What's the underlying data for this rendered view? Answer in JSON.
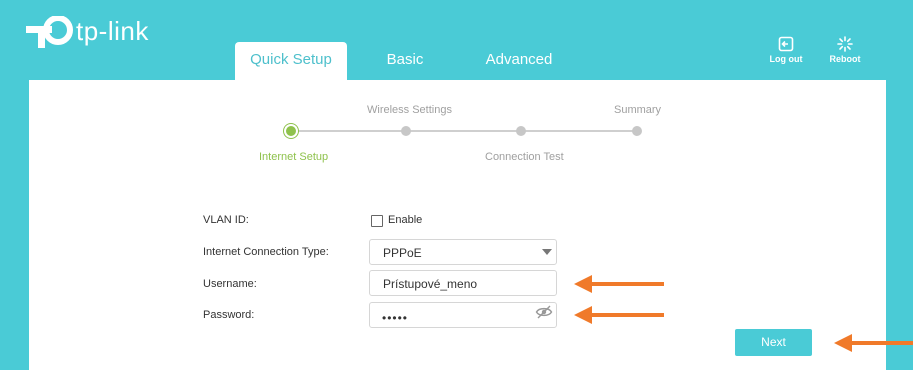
{
  "brand": {
    "name": "tp-link"
  },
  "tabs": [
    {
      "label": "Quick Setup",
      "active": true
    },
    {
      "label": "Basic",
      "active": false
    },
    {
      "label": "Advanced",
      "active": false
    }
  ],
  "toolbar": {
    "logout_label": "Log out",
    "reboot_label": "Reboot"
  },
  "steps": {
    "internet_setup": "Internet Setup",
    "wireless_settings": "Wireless Settings",
    "connection_test": "Connection Test",
    "summary": "Summary",
    "current": "Internet Setup"
  },
  "form": {
    "vlan_label": "VLAN ID:",
    "vlan_enable_label": "Enable",
    "vlan_enabled": false,
    "conn_type_label": "Internet Connection Type:",
    "conn_type_value": "PPPoE",
    "username_label": "Username:",
    "username_value": "Prístupové_meno",
    "password_label": "Password:",
    "password_value": "•••••"
  },
  "next_label": "Next",
  "colors": {
    "brand": "#4acbd6",
    "active_step": "#8fc24d",
    "annotation_arrow": "#f07a2a"
  }
}
